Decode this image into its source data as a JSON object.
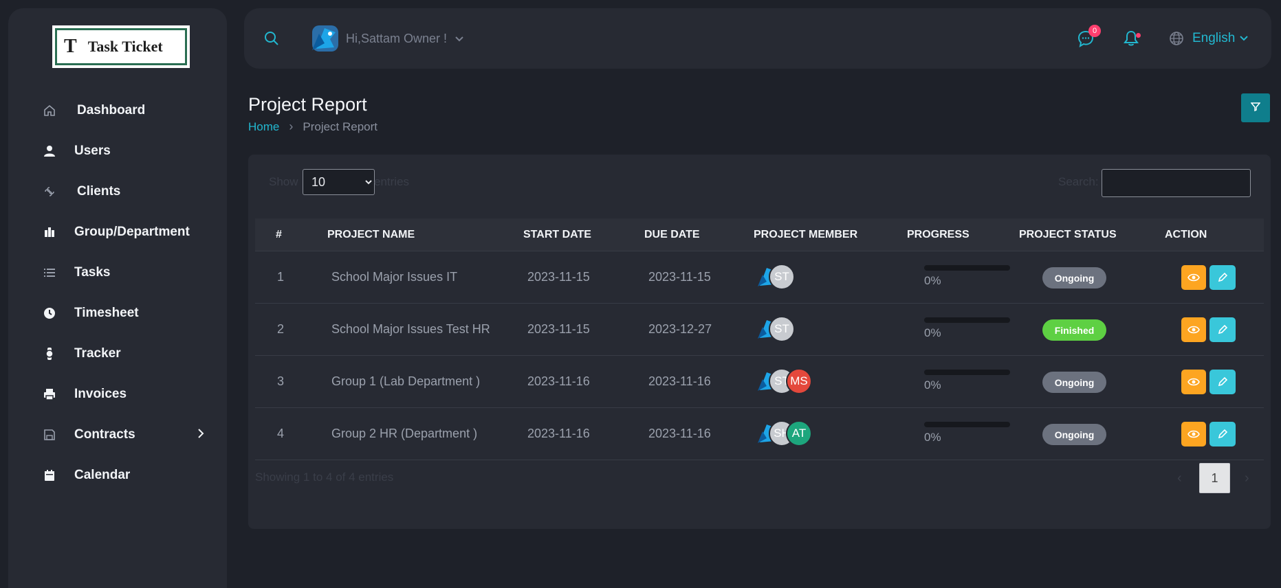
{
  "logo": {
    "letter": "T",
    "name": "Task Ticket"
  },
  "sidebar": {
    "items": [
      {
        "label": "Dashboard"
      },
      {
        "label": "Users"
      },
      {
        "label": "Clients"
      },
      {
        "label": "Group/Department"
      },
      {
        "label": "Tasks"
      },
      {
        "label": "Timesheet"
      },
      {
        "label": "Tracker"
      },
      {
        "label": "Invoices"
      },
      {
        "label": "Contracts"
      },
      {
        "label": "Calendar"
      }
    ]
  },
  "topbar": {
    "greeting": "Hi,Sattam Owner !",
    "message_badge": "0",
    "language": "English"
  },
  "page": {
    "title": "Project Report",
    "breadcrumb": {
      "home": "Home",
      "current": "Project Report"
    }
  },
  "table_controls": {
    "show_label": "Show",
    "entries_label": "entries",
    "length_value": "10",
    "search_label": "Search:"
  },
  "table": {
    "headers": [
      "#",
      "PROJECT NAME",
      "START DATE",
      "DUE DATE",
      "PROJECT MEMBER",
      "PROGRESS",
      "PROJECT STATUS",
      "ACTION"
    ],
    "rows": [
      {
        "num": "1",
        "name": "School Major Issues IT",
        "start": "2023-11-15",
        "due": "2023-11-15",
        "members": [
          "ST"
        ],
        "progress": "0%",
        "progress_value": 0,
        "status": "Ongoing"
      },
      {
        "num": "2",
        "name": "School Major Issues Test HR",
        "start": "2023-11-15",
        "due": "2023-12-27",
        "members": [
          "ST"
        ],
        "progress": "0%",
        "progress_value": 0,
        "status": "Finished"
      },
      {
        "num": "3",
        "name": "Group 1 (Lab Department )",
        "start": "2023-11-16",
        "due": "2023-11-16",
        "members": [
          "ST",
          "MS"
        ],
        "progress": "0%",
        "progress_value": 0,
        "status": "Ongoing"
      },
      {
        "num": "4",
        "name": "Group 2 HR (Department )",
        "start": "2023-11-16",
        "due": "2023-11-16",
        "members": [
          "SH",
          "AT"
        ],
        "progress": "0%",
        "progress_value": 0,
        "status": "Ongoing"
      }
    ]
  },
  "footer": {
    "info": "Showing 1 to 4 of 4 entries",
    "page": "1",
    "prev": "‹",
    "next": "›"
  },
  "colors": {
    "accent": "#22b8d0",
    "ongoing": "#6c727f",
    "finished": "#5ed043",
    "view_button": "#fda521",
    "edit_button": "#39c7da",
    "badge": "#ff3f6f"
  }
}
